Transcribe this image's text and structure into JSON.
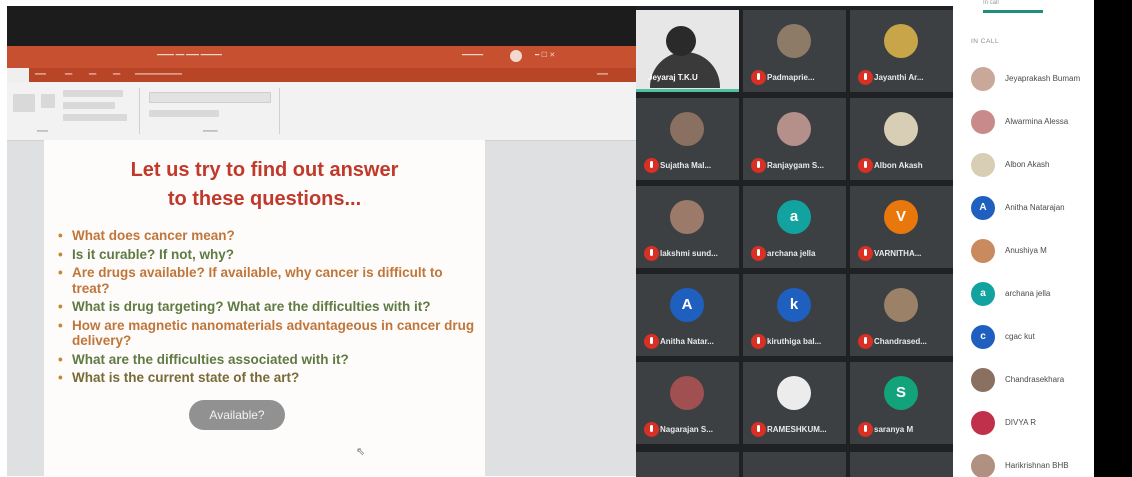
{
  "slide": {
    "title_line1": "Let us try to find out answer",
    "title_line2": "to these questions...",
    "bullets": [
      "What does cancer mean?",
      "Is it curable? If not, why?",
      "Are drugs available? If available, why cancer is difficult to treat?",
      "What is drug targeting? What are the difficulties with it?",
      "How are magnetic nanomaterials advantageous in cancer drug delivery?",
      "What are the difficulties associated with it?",
      "What is the current state of the art?"
    ],
    "caption_pill": "Available?"
  },
  "participants": [
    {
      "name": "Jeyaraj T.K.U",
      "initial": "",
      "color": "#2a2a2a"
    },
    {
      "name": "Padmaprie...",
      "initial": "",
      "color": "#8d7b68"
    },
    {
      "name": "Jayanthi Ar...",
      "initial": "",
      "color": "#c9a54a"
    },
    {
      "name": "Sujatha Mal...",
      "initial": "",
      "color": "#8a7060"
    },
    {
      "name": "Ranjaygam S...",
      "initial": "",
      "color": "#b58f8a"
    },
    {
      "name": "Albon Akash",
      "initial": "",
      "color": "#d8cdb5"
    },
    {
      "name": "lakshmi sund...",
      "initial": "",
      "color": "#9b7a6a"
    },
    {
      "name": "archana jella",
      "initial": "a",
      "color": "#12a3a0"
    },
    {
      "name": "VARNITHA...",
      "initial": "V",
      "color": "#e8780c"
    },
    {
      "name": "Anitha Natar...",
      "initial": "A",
      "color": "#1f5fbf"
    },
    {
      "name": "kiruthiga bal...",
      "initial": "k",
      "color": "#1f5fbf"
    },
    {
      "name": "Chandrased...",
      "initial": "",
      "color": "#9a8168"
    },
    {
      "name": "Nagarajan S...",
      "initial": "",
      "color": "#a05050"
    },
    {
      "name": "RAMESHKUM...",
      "initial": "",
      "color": "#ececec"
    },
    {
      "name": "saranya M",
      "initial": "S",
      "color": "#12a37a"
    }
  ],
  "people_panel": {
    "tab_label": "In call",
    "section_label": "IN CALL",
    "people": [
      {
        "name": "Jeyaprakash Bumam",
        "initial": "",
        "color": "#c9a89a"
      },
      {
        "name": "Alwarmina Alessa",
        "initial": "",
        "color": "#c98a8a"
      },
      {
        "name": "Albon Akash",
        "initial": "",
        "color": "#d8cdb5"
      },
      {
        "name": "Anitha Natarajan",
        "initial": "A",
        "color": "#1f5fbf"
      },
      {
        "name": "Anushiya M",
        "initial": "",
        "color": "#c98a60"
      },
      {
        "name": "archana jella",
        "initial": "a",
        "color": "#12a3a0"
      },
      {
        "name": "cgac kut",
        "initial": "c",
        "color": "#1f5fbf"
      },
      {
        "name": "Chandrasekhara",
        "initial": "",
        "color": "#8a7060"
      },
      {
        "name": "DIVYA R",
        "initial": "",
        "color": "#c0304a"
      },
      {
        "name": "Harikrishnan BHB",
        "initial": "",
        "color": "#b09080"
      }
    ]
  },
  "colors": {
    "accent": "#1e8e7e",
    "mic_off": "#d93025",
    "slide_title": "#c0392b",
    "titlebar": "#c6502f"
  }
}
